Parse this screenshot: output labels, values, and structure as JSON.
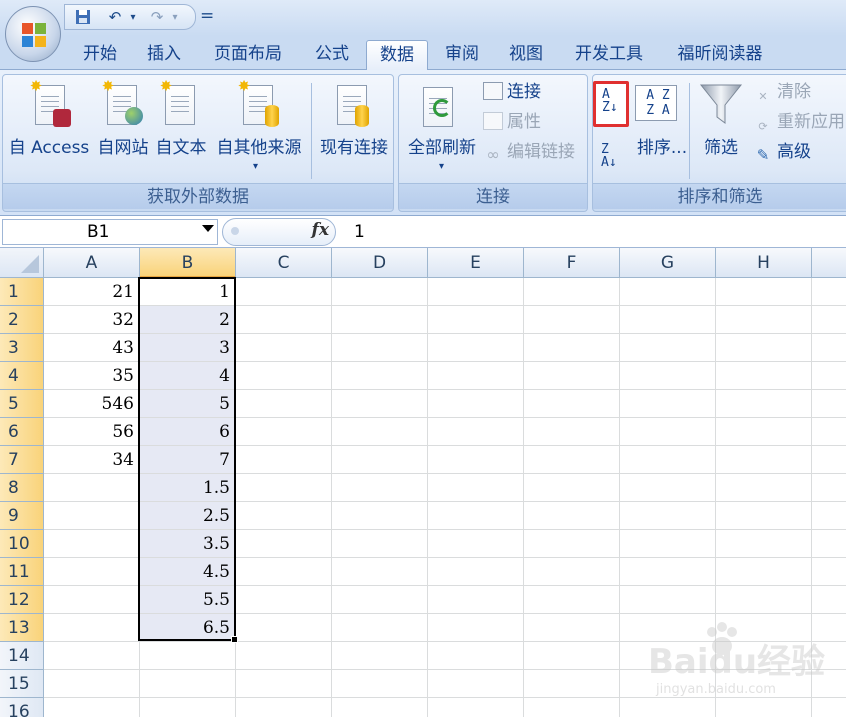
{
  "colors": {
    "accent": "#15428b",
    "selection_highlight": "#e6e9f4",
    "red_highlight": "#e03030"
  },
  "quick_access": {
    "icons": [
      "save-icon",
      "undo-icon",
      "redo-icon",
      "customize-icon"
    ],
    "dropdown_glyph": "▾",
    "customize_glyph": "="
  },
  "tabs": [
    {
      "label": "开始"
    },
    {
      "label": "插入"
    },
    {
      "label": "页面布局"
    },
    {
      "label": "公式"
    },
    {
      "label": "数据"
    },
    {
      "label": "审阅"
    },
    {
      "label": "视图"
    },
    {
      "label": "开发工具"
    },
    {
      "label": "福昕阅读器"
    }
  ],
  "active_tab": "数据",
  "groups": {
    "external": {
      "label": "获取外部数据",
      "buttons": {
        "access": "自 Access",
        "web": "自网站",
        "text": "自文本",
        "other": "自其他来源",
        "existing": "现有连接"
      }
    },
    "connections": {
      "label": "连接",
      "refresh": "全部刷新",
      "connections": "连接",
      "properties": "属性",
      "edit_links": "编辑链接"
    },
    "sort_filter": {
      "label": "排序和筛选",
      "sort": "排序...",
      "filter": "筛选",
      "clear": "清除",
      "reapply": "重新应用",
      "advanced": "高级",
      "sort_az_icon": "A\nZ↓",
      "sort_za_icon": "Z\nA↓"
    }
  },
  "formula_bar": {
    "name_box": "B1",
    "fx_label": "fx",
    "value": "1"
  },
  "columns": [
    "A",
    "B",
    "C",
    "D",
    "E",
    "F",
    "G",
    "H"
  ],
  "rows": [
    "1",
    "2",
    "3",
    "4",
    "5",
    "6",
    "7",
    "8",
    "9",
    "10",
    "11",
    "12",
    "13",
    "14",
    "15",
    "16"
  ],
  "cells": {
    "A": [
      "21",
      "32",
      "43",
      "35",
      "546",
      "56",
      "34",
      "",
      "",
      "",
      "",
      "",
      "",
      "",
      "",
      ""
    ],
    "B": [
      "1",
      "2",
      "3",
      "4",
      "5",
      "6",
      "7",
      "1.5",
      "2.5",
      "3.5",
      "4.5",
      "5.5",
      "6.5",
      "",
      "",
      ""
    ]
  },
  "watermark": {
    "brand": "Baidu经验",
    "url": "jingyan.baidu.com"
  }
}
